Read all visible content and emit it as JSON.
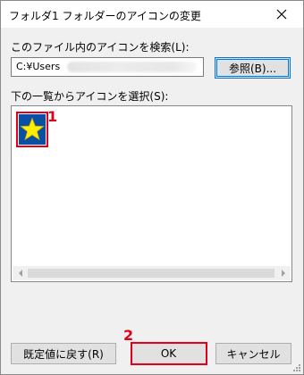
{
  "window": {
    "title": "フォルダ1 フォルダーのアイコンの変更"
  },
  "search": {
    "label": "このファイル内のアイコンを検索(L):",
    "path_value": "C:¥Users",
    "browse_label": "参照(B)..."
  },
  "icons": {
    "label": "下の一覧からアイコンを選択(S):",
    "selected_icon": "star-icon"
  },
  "annotations": {
    "step1": "1",
    "step2": "2",
    "color": "#e0001a"
  },
  "footer": {
    "restore_label": "既定値に戻す(R)",
    "ok_label": "OK",
    "cancel_label": "キャンセル"
  },
  "colors": {
    "accent": "#0078d7",
    "highlight": "#e0001a",
    "icon_bg": "#0a4fa6",
    "star": "#ffee00"
  }
}
